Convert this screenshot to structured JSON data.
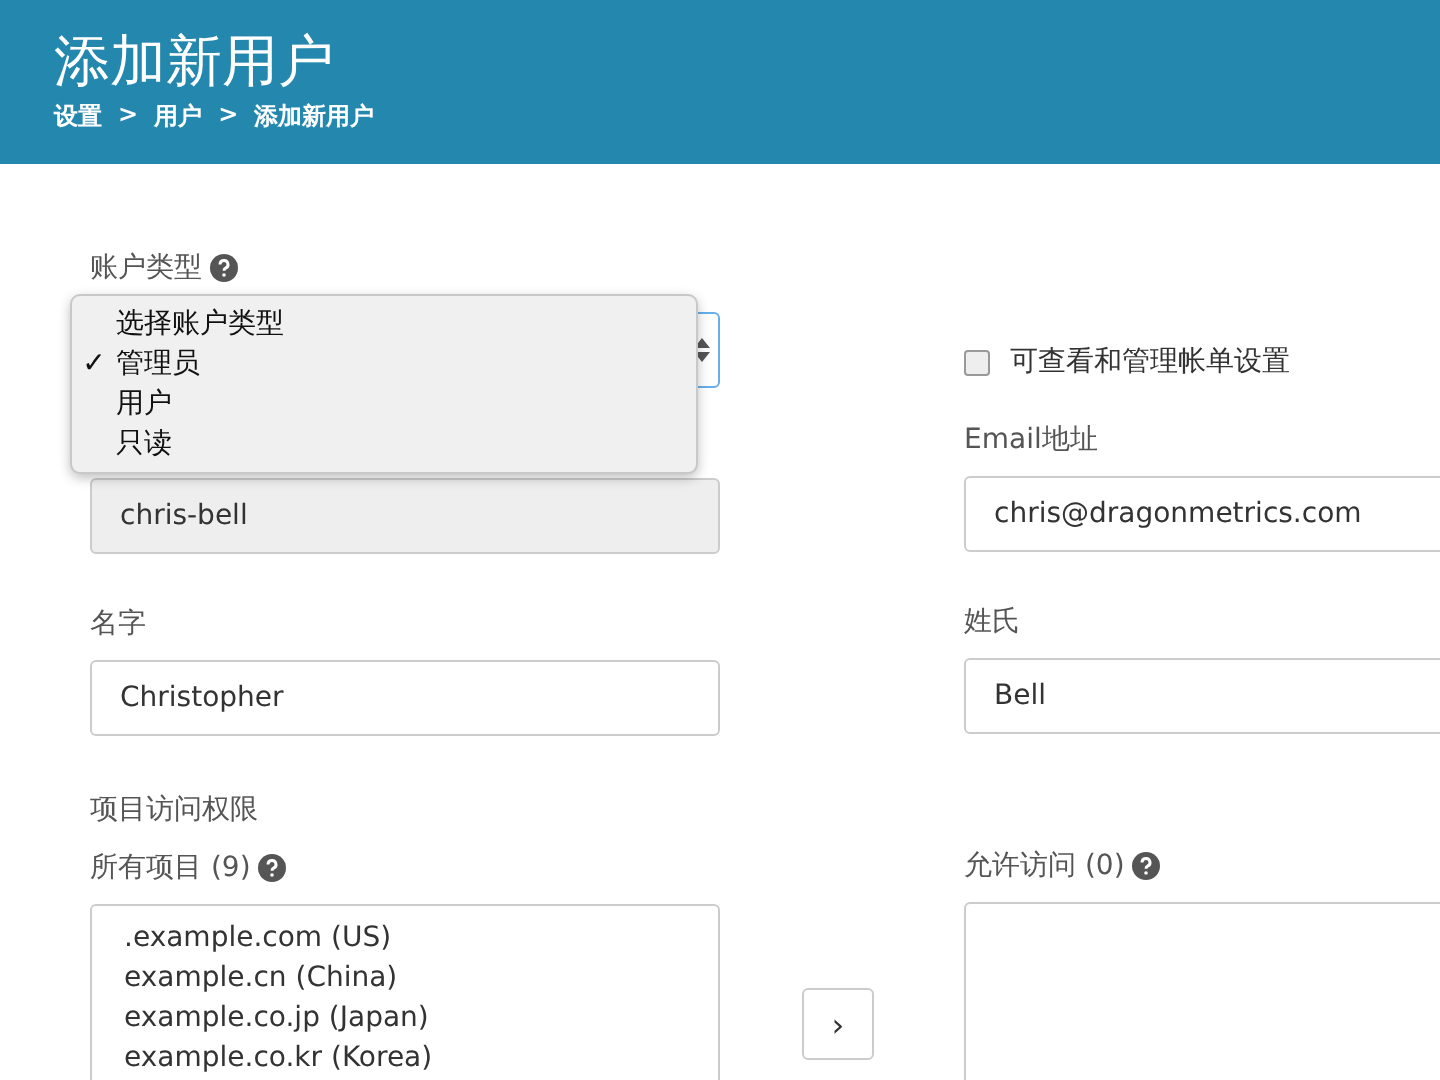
{
  "header": {
    "title": "添加新用户",
    "breadcrumb": [
      "设置",
      "用户",
      "添加新用户"
    ],
    "separator": ">"
  },
  "account_type": {
    "label": "账户类型",
    "options": [
      {
        "label": "选择账户类型",
        "selected": false
      },
      {
        "label": "管理员",
        "selected": true
      },
      {
        "label": "用户",
        "selected": false
      },
      {
        "label": "只读",
        "selected": false
      }
    ],
    "check_mark": "✓"
  },
  "billing": {
    "label": "可查看和管理帐单设置",
    "checked": false
  },
  "username": {
    "value": "chris-bell"
  },
  "email": {
    "label": "Email地址",
    "value": "chris@dragonmetrics.com"
  },
  "first_name": {
    "label": "名字",
    "value": "Christopher"
  },
  "last_name": {
    "label": "姓氏",
    "value": "Bell"
  },
  "project_access": {
    "title": "项目访问权限",
    "all_projects": {
      "label": "所有项目 (9)",
      "items": [
        ".example.com (US)",
        "example.cn (China)",
        "example.co.jp (Japan)",
        "example.co.kr (Korea)"
      ]
    },
    "move_button": "›",
    "allowed": {
      "label": "允许访问 (0)"
    }
  }
}
